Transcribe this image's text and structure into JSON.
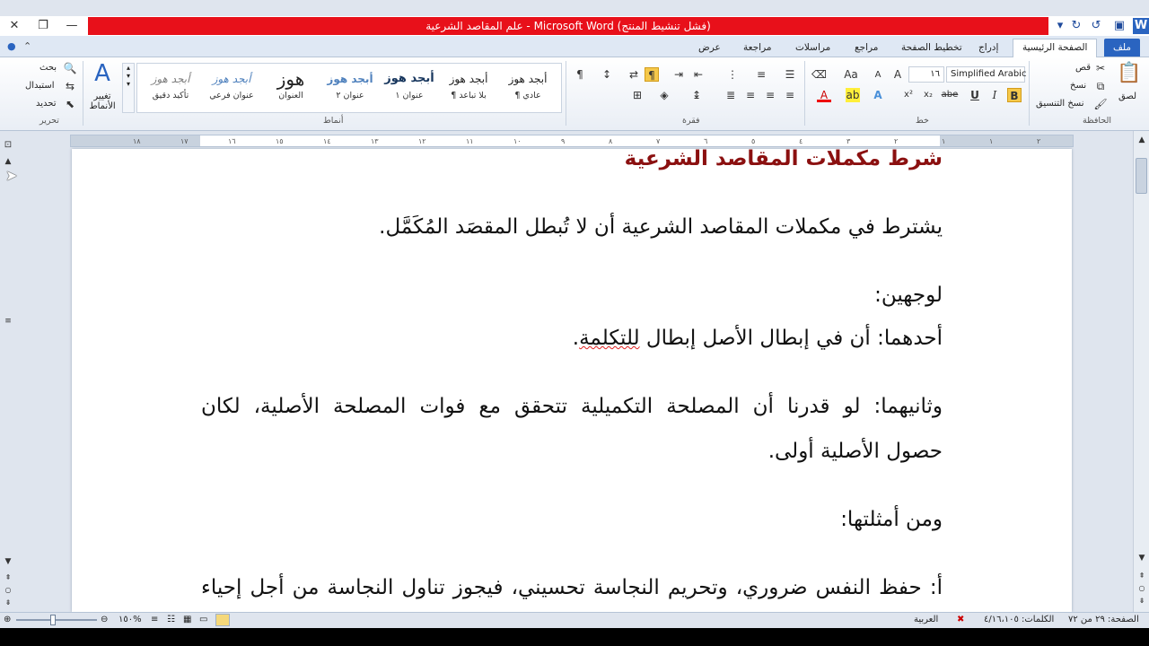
{
  "window": {
    "title": "علم المقاصد الشرعية - Microsoft Word (فشل تنشيط المنتج)",
    "accent": "#e8101a"
  },
  "tabs": [
    {
      "label": "ملف"
    },
    {
      "label": "الصفحة الرئيسية"
    },
    {
      "label": "إدراج"
    },
    {
      "label": "تخطيط الصفحة"
    },
    {
      "label": "مراجع"
    },
    {
      "label": "مراسلات"
    },
    {
      "label": "مراجعة"
    },
    {
      "label": "عرض"
    }
  ],
  "clipboard": {
    "paste": "لصق",
    "cut": "قص",
    "copy": "نسخ",
    "format_painter": "نسخ التنسيق",
    "group": "الحافظة"
  },
  "font": {
    "name": "Simplified Arabic",
    "size": "١٦",
    "group": "خط",
    "bold": "B",
    "italic": "I",
    "underline": "U",
    "strike": "abe"
  },
  "paragraph": {
    "group": "فقرة"
  },
  "styles": {
    "group": "أنماط",
    "change": "تغيير الأنماط",
    "items": [
      {
        "sample": "أبجد هوز",
        "name": "¶ عادي"
      },
      {
        "sample": "أبجد هوز",
        "name": "¶ بلا تباعد"
      },
      {
        "sample": "أبجد هوز",
        "name": "عنوان ١"
      },
      {
        "sample": "أبجد هوز",
        "name": "عنوان ٢"
      },
      {
        "sample": "هوز",
        "name": "العنوان"
      },
      {
        "sample": "أبجد هوز",
        "name": "عنوان فرعي"
      },
      {
        "sample": "أبجد هوز",
        "name": "تأكيد دقيق"
      }
    ]
  },
  "editing": {
    "find": "بحث",
    "replace": "استبدال",
    "select": "تحديد",
    "group": "تحرير"
  },
  "ruler": {
    "ticks": [
      "٢",
      "١",
      "١",
      "٢",
      "٣",
      "٤",
      "٥",
      "٦",
      "٧",
      "٨",
      "٩",
      "١٠",
      "١١",
      "١٢",
      "١٣",
      "١٤",
      "١٥",
      "١٦",
      "١٧",
      "١٨"
    ]
  },
  "document": {
    "heading": "شرط مكملات المقاصد الشرعية",
    "p1": "يشترط في مكملات المقاصد الشرعية أن لا تُبطل المقصَد المُكَمَّل.",
    "p2": "لوجهين:",
    "p3a": "أحدهما: أن في إبطال الأصل إبطال ",
    "p3b": "للتكلمة",
    "p3c": ".",
    "p4": "وثانيهما: لو قدرنا أن المصلحة التكميلية تتحقق مع فوات المصلحة الأصلية، لكان",
    "p5": "حصول الأصلية أولى.",
    "p6": "ومن أمثلتها:",
    "p7": "أ: حفظ النفس ضروري، وتحريم النجاسة تحسيني، فيجوز تناول النجاسة من أجل إحياء"
  },
  "status": {
    "page": "الصفحة: ٢٩ من ٧٢",
    "words": "الكلمات: ٤/١٦،١٠٥",
    "language": "العربية",
    "zoom": "١٥٠%"
  }
}
